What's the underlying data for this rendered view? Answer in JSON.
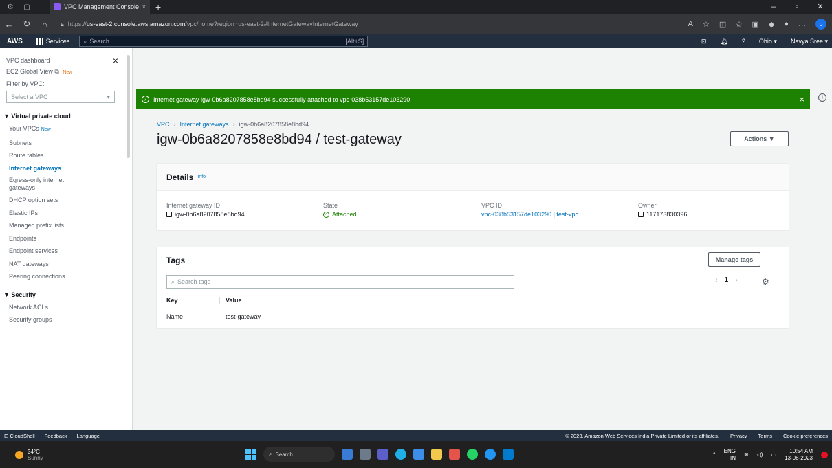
{
  "browser": {
    "tab_title": "VPC Management Console",
    "url_prefix": "https://",
    "url_host": "us-east-2.console.aws.amazon.com",
    "url_path": "/vpc/home?region=us-east-2#InternetGatewayInternetGateway"
  },
  "awsnav": {
    "logo": "AWS",
    "services": "Services",
    "search_placeholder": "Search",
    "search_shortcut": "[Alt+S]",
    "region": "Ohio ▾",
    "user": "Navya Sree ▾"
  },
  "sidebar": {
    "dashboard": "VPC dashboard",
    "ec2_global_view": "EC2 Global View",
    "ec2_badge": "New",
    "filter_label": "Filter by VPC:",
    "filter_placeholder": "Select a VPC",
    "section_vpc": "Virtual private cloud",
    "your_vpcs": "Your VPCs",
    "your_vpcs_badge": "New",
    "items": [
      "Subnets",
      "Route tables",
      "Internet gateways",
      "Egress-only internet gateways",
      "DHCP option sets",
      "Elastic IPs",
      "Managed prefix lists",
      "Endpoints",
      "Endpoint services",
      "NAT gateways",
      "Peering connections"
    ],
    "section_security": "Security",
    "security_items": [
      "Network ACLs",
      "Security groups"
    ]
  },
  "flash": {
    "message": "Internet gateway igw-0b6a8207858e8bd94 successfully attached to vpc-038b53157de103290",
    "color": "#1d8102"
  },
  "breadcrumb": {
    "vpc": "VPC",
    "igws": "Internet gateways",
    "current": "igw-0b6a8207858e8bd94"
  },
  "page": {
    "title": "igw-0b6a8207858e8bd94 / test-gateway",
    "actions": "Actions ▼"
  },
  "details": {
    "heading": "Details",
    "info": "Info",
    "igw_id_label": "Internet gateway ID",
    "igw_id": "igw-0b6a8207858e8bd94",
    "state_label": "State",
    "state": "Attached",
    "vpc_id_label": "VPC ID",
    "vpc_id": "vpc-038b53157de103290 | test-vpc",
    "owner_label": "Owner",
    "owner": "117173830396"
  },
  "tags": {
    "heading": "Tags",
    "manage": "Manage tags",
    "search_placeholder": "Search tags",
    "page": "1",
    "col_key": "Key",
    "col_value": "Value",
    "rows": [
      {
        "key": "Name",
        "value": "test-gateway"
      }
    ]
  },
  "footer": {
    "cloudshell": "CloudShell",
    "feedback": "Feedback",
    "language": "Language",
    "copyright": "© 2023, Amazon Web Services India Private Limited or its affiliates.",
    "privacy": "Privacy",
    "terms": "Terms",
    "cookie": "Cookie preferences"
  },
  "taskbar": {
    "temp": "34°C",
    "weather": "Sunny",
    "search": "Search",
    "lang": "ENG",
    "lang_sub": "IN",
    "time": "10:54 AM",
    "date": "13-08-2023"
  }
}
